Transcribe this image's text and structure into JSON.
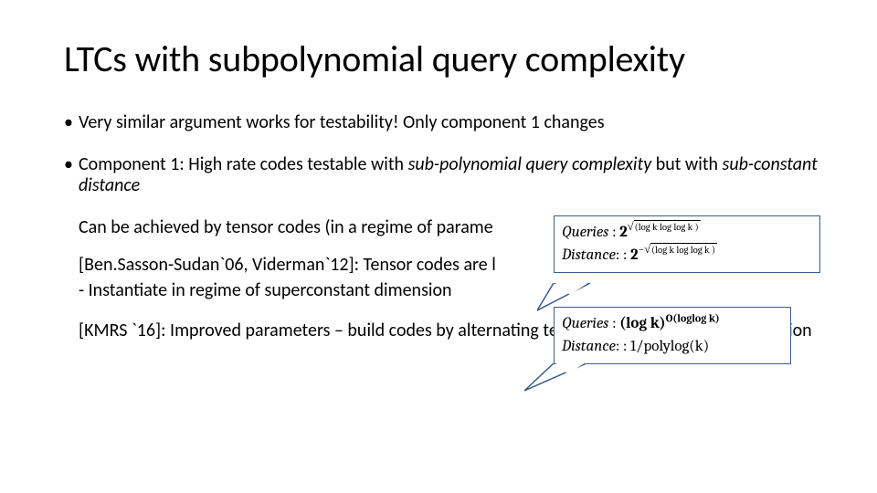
{
  "title": "LTCs with subpolynomial query complexity",
  "bullet1": "Very similar  argument works for testability!  Only component 1 changes",
  "bullet2_a": "Component 1: High rate codes testable with ",
  "bullet2_em1": "sub-polynomial query complexity",
  "bullet2_b": " but with ",
  "bullet2_em2": "sub-constant distance",
  "para1": "Can be achieved by tensor codes (in a regime of parame",
  "para2": "[Ben.Sasson-Sudan`06, Viderman`12]: Tensor codes are l",
  "para3": "-  Instantiate in regime of superconstant dimension",
  "para4": "[KMRS `16]: Improved parameters – build codes by alternating tensoring and distance amplification",
  "call1": {
    "q_label": "Queries",
    "q_colon": " : ",
    "q_base": "2",
    "q_rad": "(log k log log k )",
    "d_label": "Distance",
    "d_colon": ": : ",
    "d_base": "2",
    "d_neg": "−",
    "d_rad": "(log k log log k )"
  },
  "call2": {
    "q_label": "Queries",
    "q_colon": " : ",
    "q_expr_a": "(log k)",
    "q_sup": "O(loglog k)",
    "d_label": "Distance",
    "d_colon": ": : ",
    "d_expr": "1/polylog(k)"
  }
}
